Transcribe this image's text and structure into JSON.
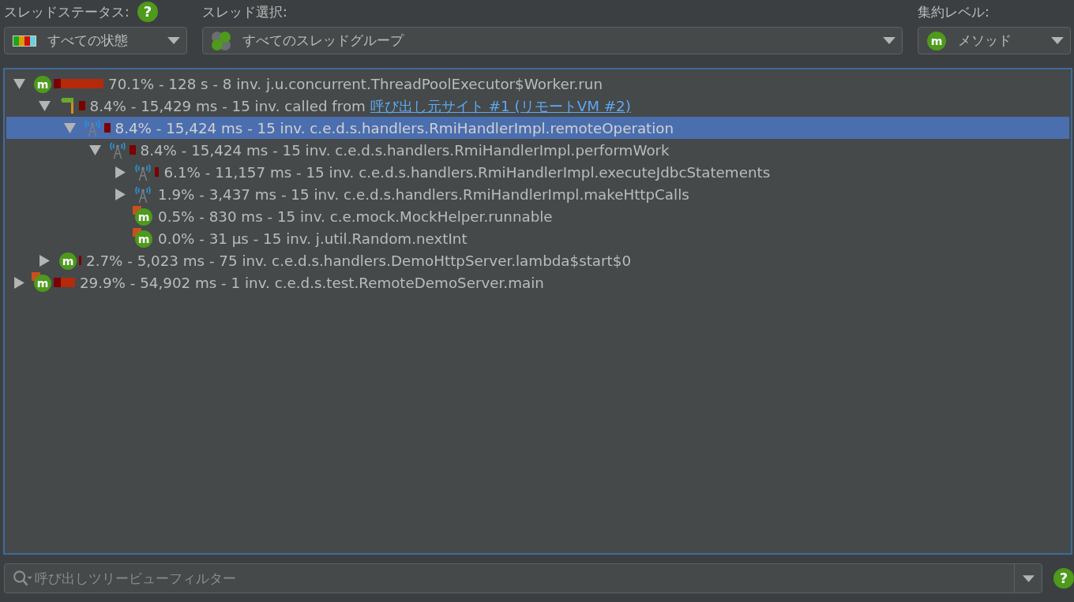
{
  "help_icon": "?",
  "toolbar": {
    "thread_status": {
      "label": "スレッドステータス:",
      "value": "すべての状態"
    },
    "thread_selection": {
      "label": "スレッド選択:",
      "value": "すべてのスレッドグループ"
    },
    "aggregation_level": {
      "label": "集約レベル:",
      "value": "メソッド",
      "icon_letter": "m"
    }
  },
  "tree": [
    {
      "kind": "method",
      "icon_letter": "m",
      "expanded": true,
      "selected": false,
      "text": "70.1% - 128 s - 8 inv. j.u.concurrent.ThreadPoolExecutor$Worker.run",
      "children": [
        {
          "kind": "callsite",
          "expanded": true,
          "selected": false,
          "text": "8.4% - 15,429 ms - 15 inv. called from",
          "link": "呼び出し元サイト #1 (リモートVM #2)",
          "children": [
            {
              "kind": "rmi",
              "expanded": true,
              "selected": true,
              "text": "8.4% - 15,424 ms - 15 inv. c.e.d.s.handlers.RmiHandlerImpl.remoteOperation",
              "children": [
                {
                  "kind": "rmi",
                  "expanded": true,
                  "selected": false,
                  "text": "8.4% - 15,424 ms - 15 inv. c.e.d.s.handlers.RmiHandlerImpl.performWork",
                  "children": [
                    {
                      "kind": "rmi",
                      "expanded": false,
                      "selected": false,
                      "text": "6.1% - 11,157 ms - 15 inv. c.e.d.s.handlers.RmiHandlerImpl.executeJdbcStatements"
                    },
                    {
                      "kind": "rmi",
                      "expanded": false,
                      "selected": false,
                      "text": "1.9% - 3,437 ms - 15 inv. c.e.d.s.handlers.RmiHandlerImpl.makeHttpCalls"
                    },
                    {
                      "kind": "method_hot",
                      "icon_letter": "m",
                      "selected": false,
                      "text": "0.5% - 830 ms - 15 inv. c.e.mock.MockHelper.runnable"
                    },
                    {
                      "kind": "method_hot",
                      "icon_letter": "m",
                      "selected": false,
                      "text": "0.0% - 31 µs - 15 inv. j.util.Random.nextInt"
                    }
                  ]
                }
              ]
            }
          ]
        },
        {
          "kind": "method",
          "icon_letter": "m",
          "expanded": false,
          "selected": false,
          "text": "2.7% - 5,023 ms - 75 inv. c.e.d.s.handlers.DemoHttpServer.lambda$start$0"
        }
      ]
    },
    {
      "kind": "method_hot",
      "icon_letter": "m",
      "expanded": false,
      "selected": false,
      "text": "29.9% - 54,902 ms - 1 inv. c.e.d.s.test.RemoteDemoServer.main"
    }
  ],
  "filter": {
    "placeholder": "呼び出しツリービューフィルター"
  }
}
